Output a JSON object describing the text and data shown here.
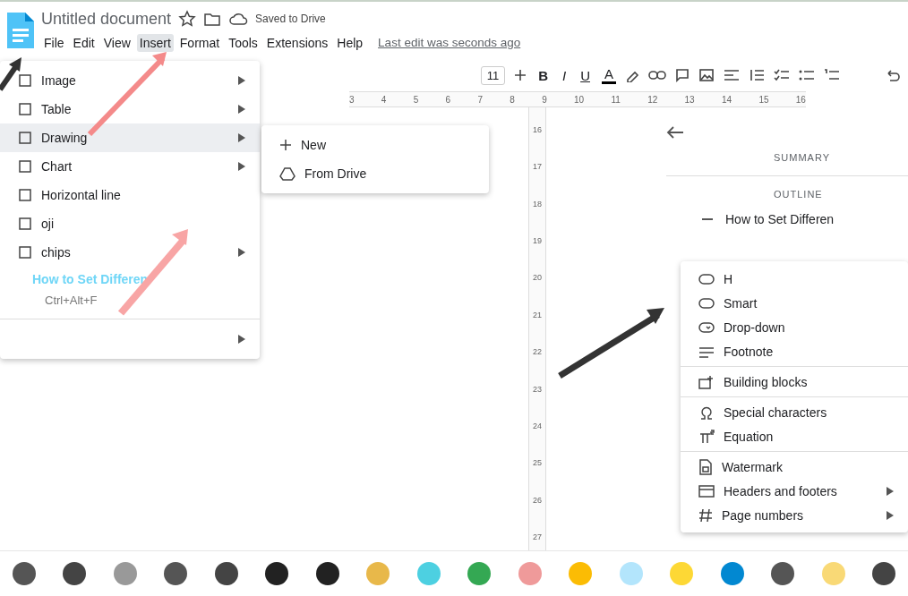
{
  "header": {
    "title": "Untitled document",
    "save_status": "Saved to Drive"
  },
  "menubar": [
    {
      "label": "File",
      "selected": false
    },
    {
      "label": "Edit",
      "selected": false
    },
    {
      "label": "View",
      "selected": false
    },
    {
      "label": "Insert",
      "selected": true
    },
    {
      "label": "Format",
      "selected": false
    },
    {
      "label": "Tools",
      "selected": false
    },
    {
      "label": "Extensions",
      "selected": false
    },
    {
      "label": "Help",
      "selected": false
    }
  ],
  "last_edit": "Last edit was seconds ago",
  "toolbar": {
    "font_size": "11",
    "format_buttons": [
      {
        "label": "B",
        "kind": "bold"
      },
      {
        "label": "I",
        "kind": "italic"
      },
      {
        "label": "U",
        "kind": "underline"
      },
      {
        "label": "A",
        "kind": "text-color"
      }
    ]
  },
  "ruler": [
    "3",
    "4",
    "5",
    "6",
    "7",
    "8",
    "9",
    "10",
    "11",
    "12",
    "13",
    "14",
    "15",
    "16"
  ],
  "vertical_ruler": [
    "16",
    "17",
    "18",
    "19",
    "20",
    "21",
    "22",
    "23",
    "24",
    "25",
    "26",
    "27"
  ],
  "insert_menu": {
    "items": [
      {
        "label": "Image",
        "kind": "item",
        "highlighted": false,
        "has_submenu": true
      },
      {
        "label": "Table",
        "kind": "item",
        "highlighted": false,
        "has_submenu": true
      },
      {
        "label": "Drawing",
        "kind": "item",
        "highlighted": true,
        "has_submenu": true
      },
      {
        "label": "Chart",
        "kind": "item",
        "highlighted": false,
        "has_submenu": true
      },
      {
        "label": "Horizontal line",
        "kind": "item",
        "highlighted": false,
        "has_submenu": false
      },
      {
        "label": "oji",
        "kind": "item",
        "highlighted": false,
        "has_submenu": false
      },
      {
        "label": "chips",
        "kind": "item",
        "highlighted": false,
        "has_submenu": true
      },
      {
        "label": "How to Set Differen",
        "kind": "link"
      },
      {
        "label": "Ctrl+Alt+F",
        "kind": "shortcut"
      },
      {
        "kind": "divider"
      },
      {
        "kind": "arrow",
        "has_submenu": true
      }
    ]
  },
  "drawing_submenu": [
    {
      "label": "New",
      "kind": "new"
    },
    {
      "label": "From Drive",
      "kind": "drive"
    }
  ],
  "outline_panel": {
    "summary_heading": "SUMMARY",
    "outline_heading": "OUTLINE",
    "outline_items": [
      "How to Set Differen"
    ]
  },
  "insert_menu_right": [
    {
      "label": "H",
      "kind": "chip",
      "has_submenu": false
    },
    {
      "label": "Smart",
      "kind": "chip",
      "has_submenu": false
    },
    {
      "label": "Drop-down",
      "kind": "dropdown",
      "has_submenu": false
    },
    {
      "label": "Footnote",
      "kind": "footnote",
      "has_submenu": false
    },
    {
      "kind": "divider"
    },
    {
      "label": "Building blocks",
      "kind": "blocks",
      "has_submenu": false
    },
    {
      "kind": "divider"
    },
    {
      "label": "Special characters",
      "kind": "omega",
      "has_submenu": false
    },
    {
      "label": "Equation",
      "kind": "equation",
      "has_submenu": false
    },
    {
      "kind": "divider"
    },
    {
      "label": "Watermark",
      "kind": "watermark",
      "has_submenu": false
    },
    {
      "label": "Headers and footers",
      "kind": "header",
      "has_submenu": true
    },
    {
      "label": "Page numbers",
      "kind": "hash",
      "has_submenu": true
    }
  ]
}
